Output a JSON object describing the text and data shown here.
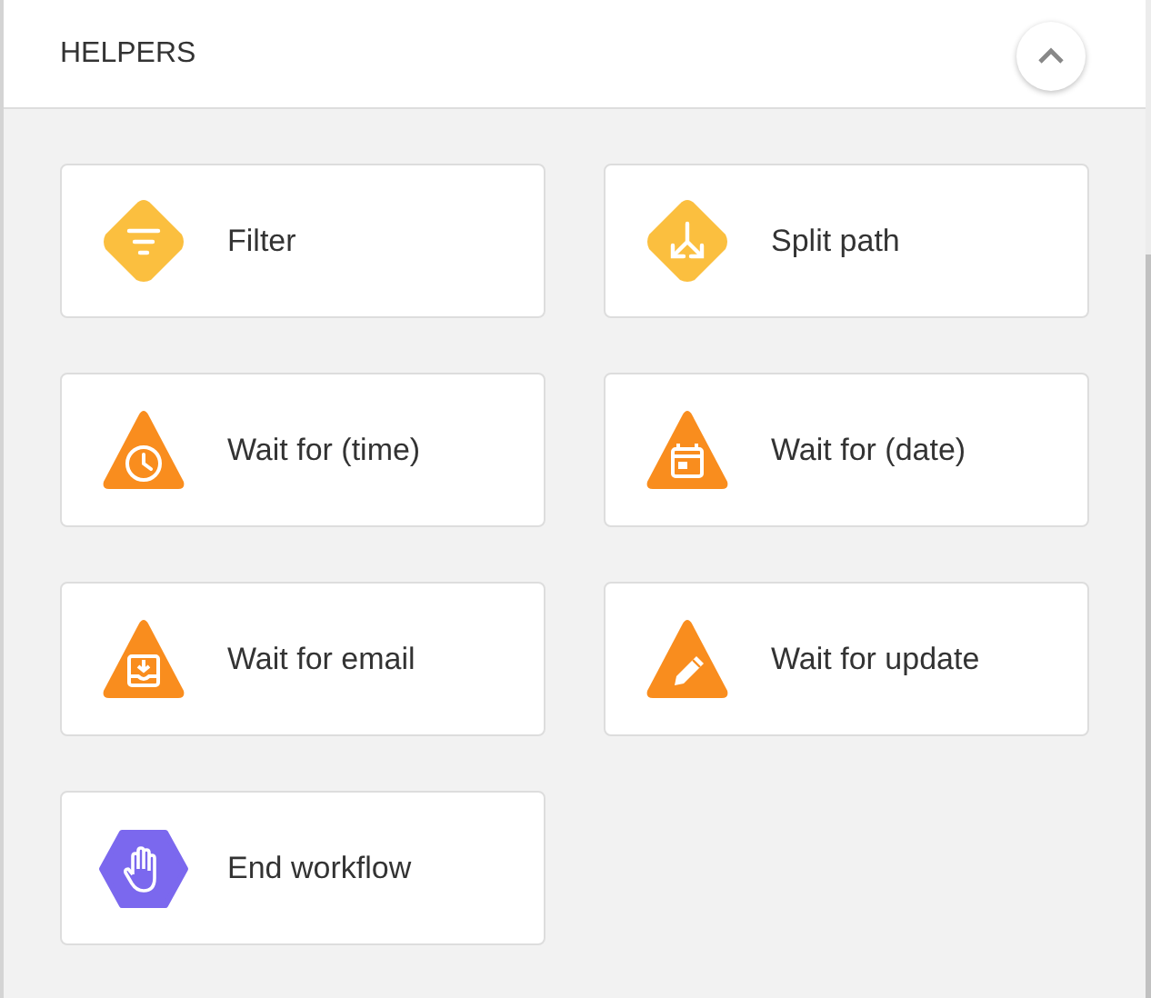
{
  "section": {
    "title": "HELPERS",
    "expanded": true
  },
  "helpers": [
    {
      "label": "Filter",
      "kind": "filter"
    },
    {
      "label": "Split path",
      "kind": "split"
    },
    {
      "label": "Wait for (time)",
      "kind": "time"
    },
    {
      "label": "Wait for (date)",
      "kind": "date"
    },
    {
      "label": "Wait for email",
      "kind": "email"
    },
    {
      "label": "Wait for update",
      "kind": "update"
    },
    {
      "label": "End workflow",
      "kind": "end"
    }
  ]
}
